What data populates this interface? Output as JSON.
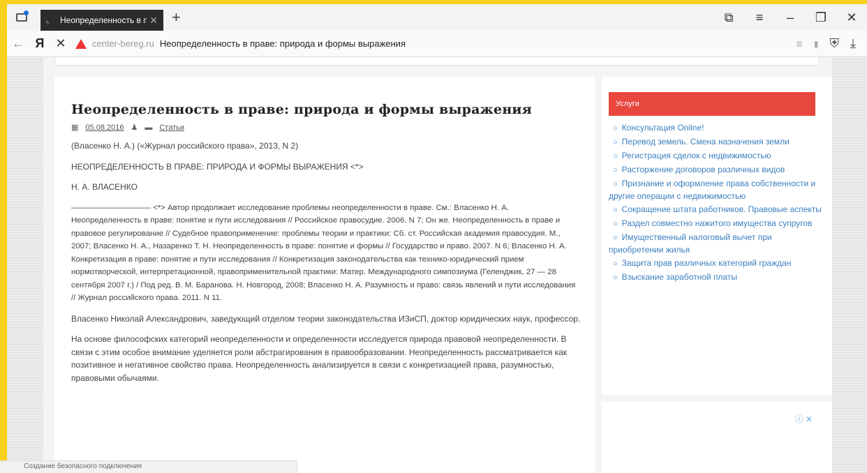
{
  "browser": {
    "tab_title": "Неопределенность в пр",
    "url_host": "center-bereg.ru",
    "page_title": "Неопределенность в праве: природа и формы выражения",
    "yandex_label": "Я",
    "status_text": "Создание безопасного подключения"
  },
  "article": {
    "title": "Неопределенность в праве: природа и формы выражения",
    "date": "05.08.2016",
    "category": "Статьи",
    "paragraphs": [
      "(Власенко Н. А.) («Журнал российского права», 2013, N 2)",
      "НЕОПРЕДЕЛЕННОСТЬ В ПРАВЕ: ПРИРОДА И ФОРМЫ ВЫРАЖЕНИЯ <*>",
      "Н. А. ВЛАСЕНКО",
      "—————————— <*> Автор продолжает исследование проблемы неопределенности в праве. См.: Власенко Н. А. Неопределенность в праве: понятие и пути исследования // Российское правосудие. 2006. N 7; Он же. Неопределенность в праве и правовое регулирование // Судебное правоприменение: проблемы теории и практики: Сб. ст. Российская академия правосудия. М., 2007; Власенко Н. А., Назаренко Т. Н. Неопределенность в праве: понятие и формы // Государство и право. 2007. N 6; Власенко Н. А. Конкретизация в праве: понятие и пути исследования // Конкретизация законодательства как технико-юридический прием нормотворческой, интерпретационной, правоприменительной практики: Матер. Международного симпозиума (Геленджик, 27 — 28 сентября 2007 г.) / Под ред. В. М. Баранова. Н. Новгород, 2008; Власенко Н. А. Разумность и право: связь явлений и пути исследования // Журнал российского права. 2011. N 11.",
      "Власенко Николай Александрович, заведующий отделом теории законодательства ИЗиСП, доктор юридических наук, профессор.",
      "На основе философских категорий неопределенности и определенности исследуется природа правовой неопределенности. В связи с этим особое внимание уделяется роли абстрагирования в правообразовании. Неопределенность рассматривается как позитивное и негативное свойство права. Неопределенность анализируется в связи с конкретизацией права, разумностью, правовыми обычаями."
    ]
  },
  "sidebar": {
    "widget_title": "Услуги",
    "services": [
      "Консультация Online!",
      "Перевод земель. Смена назначения земли",
      "Регистрация сделок с недвижимостью",
      "Расторжение договоров различных видов",
      "Признание и оформление права собственности и другие операции с недвижимостью",
      "Сокращение штата работников. Правовые аспекты",
      "Раздел совместно нажитого имущества супругов",
      "Имущественный налоговый вычет при приобретении жилья",
      "Защита прав различных категорий граждан",
      "Взыскание заработной платы"
    ]
  },
  "colors": {
    "frame": "#f7d11e",
    "widget_header": "#e8473e",
    "link": "#3a7fbf"
  }
}
